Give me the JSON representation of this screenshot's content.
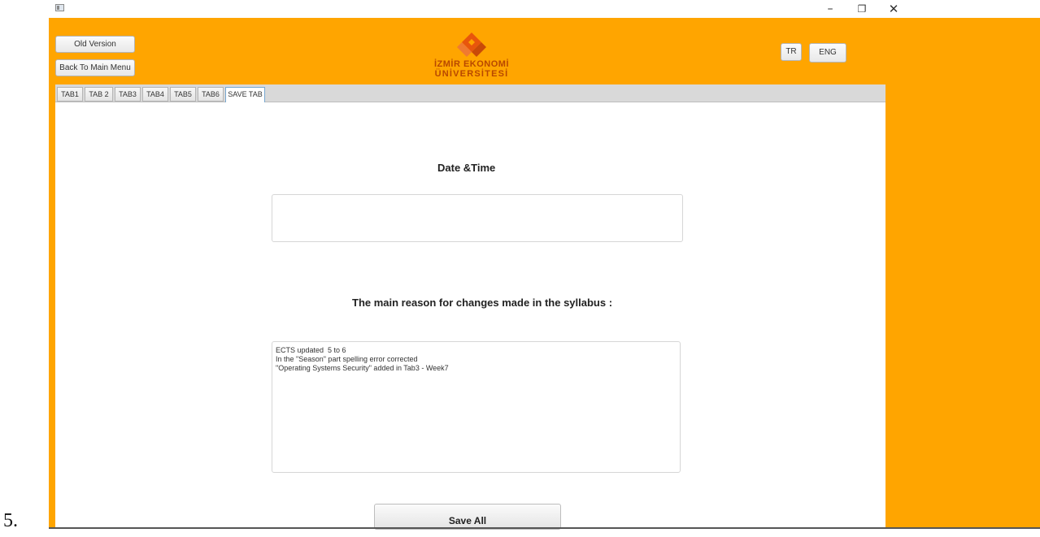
{
  "list_number": "5.",
  "titlebar": {
    "minimize": "–",
    "maximize": "❐",
    "close": "✕"
  },
  "header": {
    "old_version": "Old Version",
    "back_to_main_menu": "Back To Main Menu",
    "lang_tr": "TR",
    "lang_eng": "ENG",
    "logo_line1": "İZMİR EKONOMİ",
    "logo_line2": "ÜNİVERSİTESİ"
  },
  "tabs": [
    "TAB1",
    "TAB 2",
    "TAB3",
    "TAB4",
    "TAB5",
    "TAB6",
    "SAVE TAB"
  ],
  "active_tab": "SAVE TAB",
  "form": {
    "date_time_label": "Date &Time",
    "date_time_value": "",
    "reason_label": "The main reason for changes made in the syllabus :",
    "reason_lines": [
      "ECTS updated  5 to 6",
      "In the \"Season\" part spelling error corrected",
      "\"Operating Systems Security\" added in Tab3 - Week7"
    ],
    "save_all": "Save All"
  },
  "colors": {
    "window_bg": "#ffa500",
    "logo": "#e8560c"
  }
}
